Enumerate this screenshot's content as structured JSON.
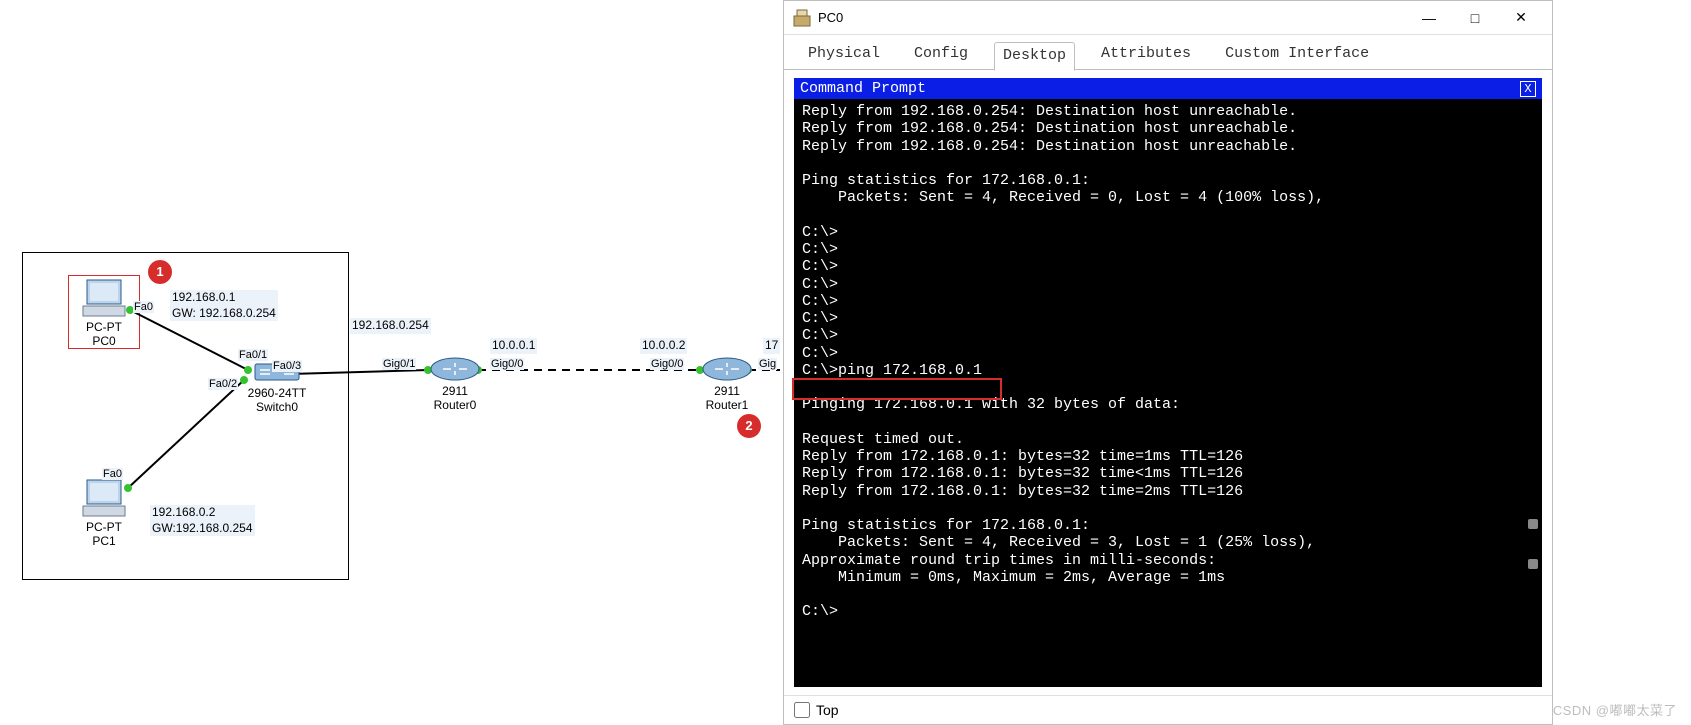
{
  "callouts": {
    "c1": "1",
    "c2": "2"
  },
  "devices": {
    "pc0": {
      "type": "PC-PT",
      "name": "PC0",
      "ip": "192.168.0.1",
      "gw": "GW: 192.168.0.254",
      "port": "Fa0"
    },
    "pc1": {
      "type": "PC-PT",
      "name": "PC1",
      "ip": "192.168.0.2",
      "gw": "GW:192.168.0.254",
      "port": "Fa0"
    },
    "sw0": {
      "type": "2960-24TT",
      "name": "Switch0",
      "p1": "Fa0/1",
      "p2": "Fa0/2",
      "p3": "Fa0/3"
    },
    "r0": {
      "type": "2911",
      "name": "Router0",
      "ip_lan": "192.168.0.254",
      "ip_wan": "10.0.0.1",
      "p_lan": "Gig0/1",
      "p_wan": "Gig0/0"
    },
    "r1": {
      "type": "2911",
      "name": "Router1",
      "ip_wan": "10.0.0.2",
      "ip_lan_cut": "17",
      "p_wan": "Gig0/0",
      "p_lan": "Gig"
    }
  },
  "window": {
    "title": "PC0",
    "tabs": [
      "Physical",
      "Config",
      "Desktop",
      "Attributes",
      "Custom Interface"
    ],
    "active_tab": 2,
    "cmd_title": "Command Prompt",
    "cmd_close": "X",
    "top_label": "Top",
    "minimize": "—",
    "maximize": "□",
    "close": "✕"
  },
  "terminal_lines": [
    "Reply from 192.168.0.254: Destination host unreachable.",
    "Reply from 192.168.0.254: Destination host unreachable.",
    "Reply from 192.168.0.254: Destination host unreachable.",
    "",
    "Ping statistics for 172.168.0.1:",
    "    Packets: Sent = 4, Received = 0, Lost = 4 (100% loss),",
    "",
    "C:\\>",
    "C:\\>",
    "C:\\>",
    "C:\\>",
    "C:\\>",
    "C:\\>",
    "C:\\>",
    "C:\\>",
    "C:\\>ping 172.168.0.1",
    "",
    "Pinging 172.168.0.1 with 32 bytes of data:",
    "",
    "Request timed out.",
    "Reply from 172.168.0.1: bytes=32 time=1ms TTL=126",
    "Reply from 172.168.0.1: bytes=32 time<1ms TTL=126",
    "Reply from 172.168.0.1: bytes=32 time=2ms TTL=126",
    "",
    "Ping statistics for 172.168.0.1:",
    "    Packets: Sent = 4, Received = 3, Lost = 1 (25% loss),",
    "Approximate round trip times in milli-seconds:",
    "    Minimum = 0ms, Maximum = 2ms, Average = 1ms",
    "",
    "C:\\>"
  ],
  "watermark": "CSDN @嘟嘟太菜了"
}
